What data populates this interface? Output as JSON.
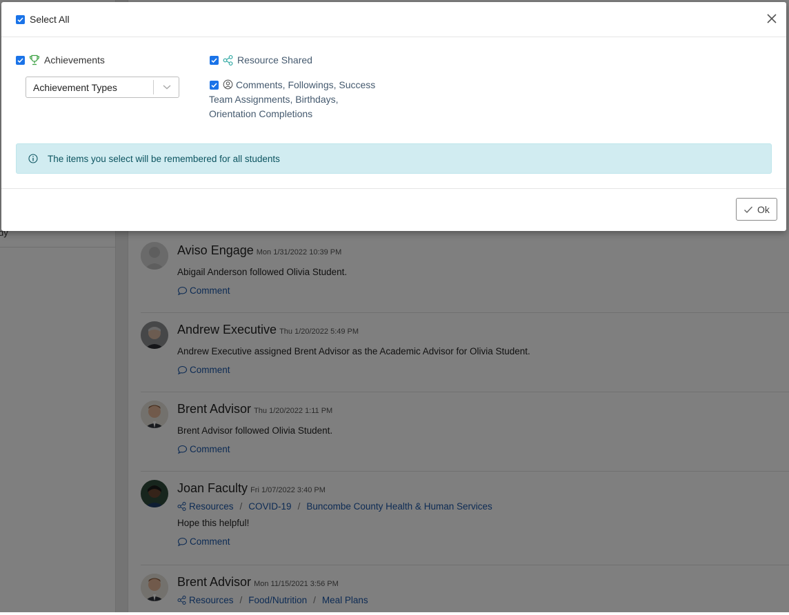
{
  "modal": {
    "select_all_label": "Select All",
    "options": {
      "achievements": "Achievements",
      "resource_shared": "Resource Shared",
      "comments_line1": "Comments, Followings, Success",
      "comments_line2": "Team Assignments, Birthdays,",
      "comments_line3": "Orientation Completions"
    },
    "achievement_types_select": {
      "value": "Achievement Types"
    },
    "info_alert": "The items you select will be remembered for all students",
    "ok_label": "Ok"
  },
  "background": {
    "left_panel_snippet": "dy",
    "posts": [
      {
        "author": "Aviso Engage",
        "timestamp": "Mon 1/31/2022 10:39 PM",
        "text": "Abigail Anderson followed Olivia Student.",
        "comment_label": "Comment"
      },
      {
        "author": "Andrew Executive",
        "timestamp": "Thu 1/20/2022 5:49 PM",
        "text": "Andrew Executive assigned Brent Advisor as the Academic Advisor for Olivia Student.",
        "comment_label": "Comment"
      },
      {
        "author": "Brent Advisor",
        "timestamp": "Thu 1/20/2022 1:11 PM",
        "text": "Brent Advisor followed Olivia Student.",
        "comment_label": "Comment"
      },
      {
        "author": "Joan Faculty",
        "timestamp": "Fri 1/07/2022 3:40 PM",
        "crumbs": [
          "Resources",
          "COVID-19",
          "Buncombe County Health & Human Services"
        ],
        "text": "Hope this helpful!",
        "comment_label": "Comment"
      },
      {
        "author": "Brent Advisor",
        "timestamp": "Mon 11/15/2021 3:56 PM",
        "crumbs": [
          "Resources",
          "Food/Nutrition",
          "Meal Plans"
        ]
      }
    ]
  },
  "colors": {
    "checkbox": "#1a73e8",
    "trophy": "#3aa041",
    "share_icon": "#2aa6a0",
    "link": "#1a56a8",
    "alert_bg": "#d1ecf1",
    "alert_text": "#0c5460"
  }
}
